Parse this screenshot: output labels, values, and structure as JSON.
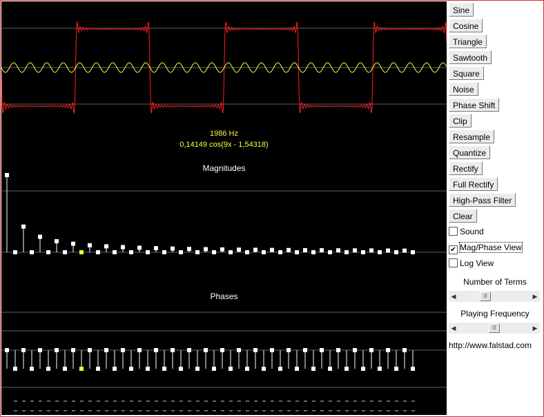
{
  "app": {
    "url": "http://www.falstad.com"
  },
  "display": {
    "frequency": "1986 Hz",
    "term_formula": "0,14149 cos(9x - 1,54318)",
    "magnitudes_title": "Magnitudes",
    "phases_title": "Phases",
    "selected_term": 5
  },
  "buttons": [
    "Sine",
    "Cosine",
    "Triangle",
    "Sawtooth",
    "Square",
    "Noise",
    "Phase Shift",
    "Clip",
    "Resample",
    "Quantize",
    "Rectify",
    "Full Rectify",
    "High-Pass Filter",
    "Clear"
  ],
  "checkboxes": [
    {
      "label": "Sound",
      "checked": false
    },
    {
      "label": "Mag/Phase View",
      "checked": true
    },
    {
      "label": "Log View",
      "checked": false
    }
  ],
  "sliders": [
    {
      "label": "Number of Terms",
      "value_fraction": 0.35
    },
    {
      "label": "Playing Frequency",
      "value_fraction": 0.5
    }
  ],
  "colors": {
    "background": "#000000",
    "waveform": "#ff2020",
    "selected_term_wave": "#ffff40",
    "dots": "#ffffff",
    "selected_dot": "#ffff30",
    "grid": "#606060"
  },
  "magnitudes": [
    1.0,
    0,
    0.333,
    0,
    0.2,
    0,
    0.143,
    0,
    0.111,
    0,
    0.091,
    0,
    0.077,
    0,
    0.067,
    0,
    0.059,
    0,
    0.053,
    0,
    0.048,
    0,
    0.043,
    0,
    0.04,
    0,
    0.037,
    0,
    0.034,
    0,
    0.032,
    0,
    0.03,
    0,
    0.029,
    0,
    0.027,
    0,
    0.026,
    0,
    0.025,
    0,
    0.024,
    0,
    0.023,
    0,
    0.022,
    0,
    0.021,
    0
  ],
  "phases": [
    1,
    -1,
    1,
    -1,
    1,
    -1,
    1,
    -1,
    1,
    -1,
    1,
    -1,
    1,
    -1,
    1,
    -1,
    1,
    -1,
    1,
    -1,
    1,
    -1,
    1,
    -1,
    1,
    -1,
    1,
    -1,
    1,
    -1,
    1,
    -1,
    1,
    -1,
    1,
    -1,
    1,
    -1,
    1,
    -1,
    1,
    -1,
    1,
    -1,
    1,
    -1,
    1,
    -1,
    1,
    -1
  ]
}
